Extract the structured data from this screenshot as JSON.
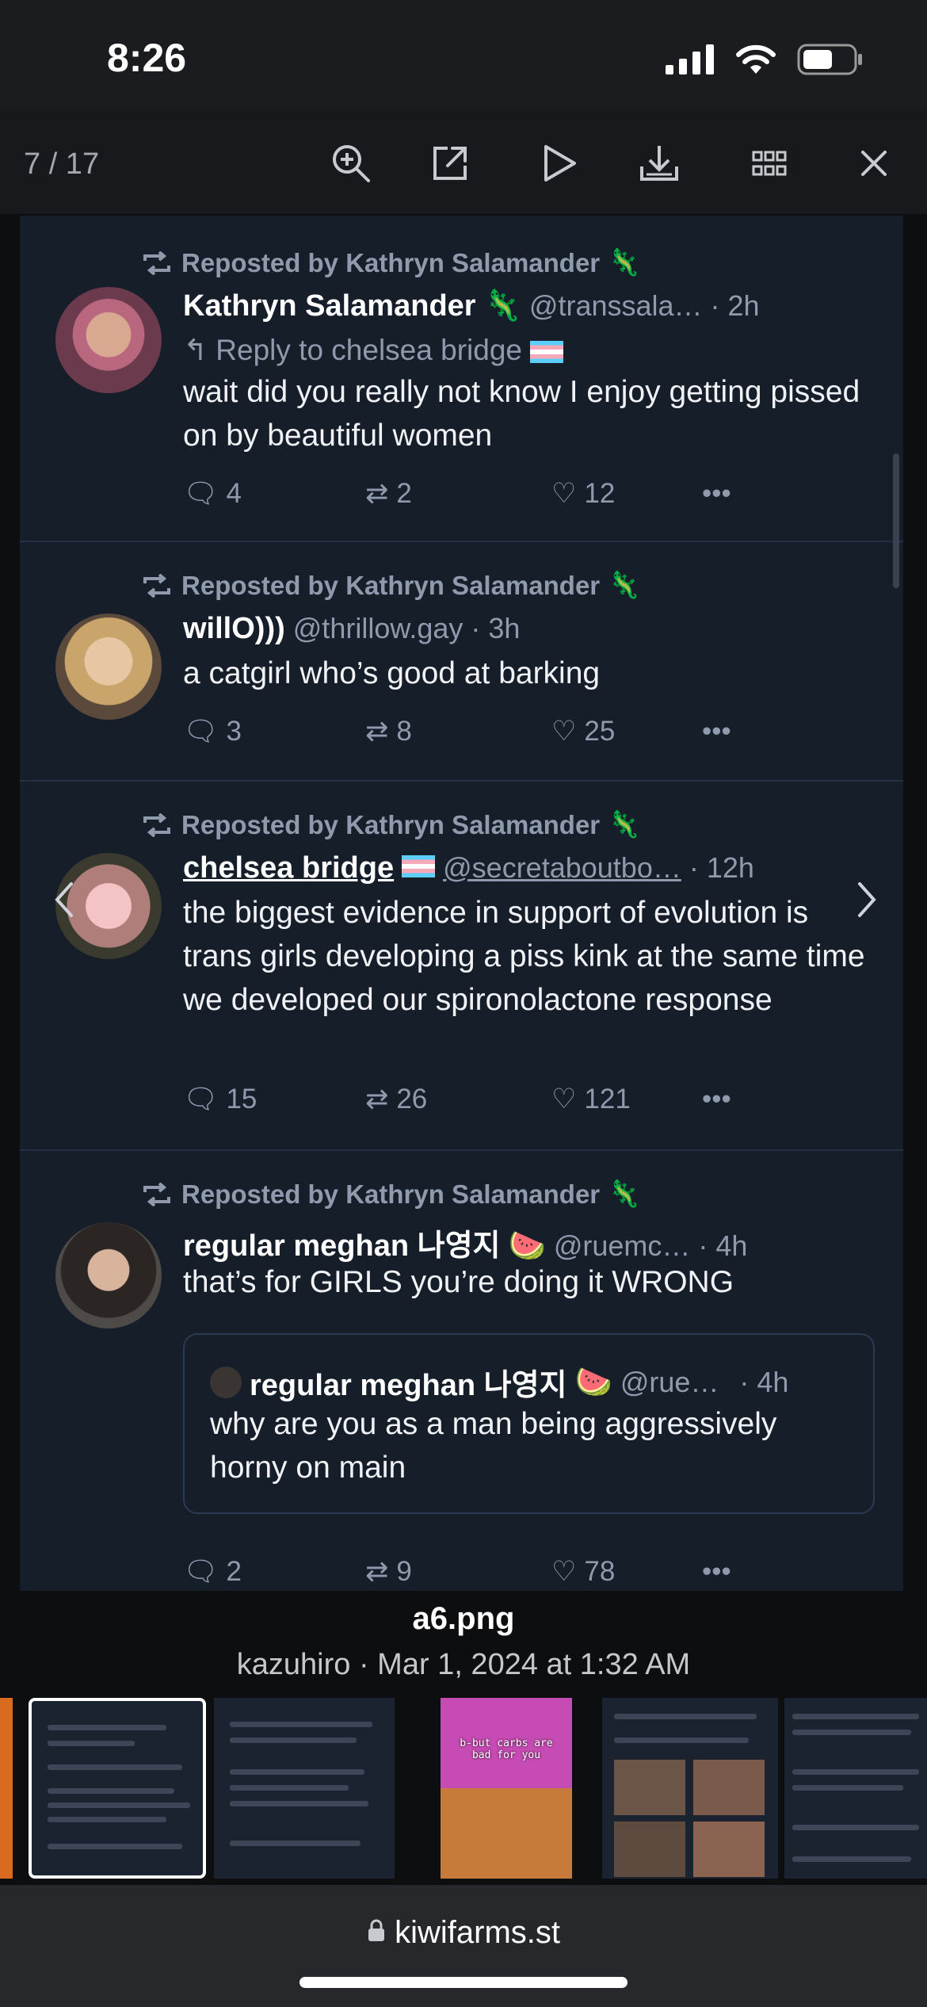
{
  "status_bar": {
    "time": "8:26"
  },
  "viewer": {
    "counter": "7 / 17",
    "icons": [
      "zoom-in-icon",
      "open-external-icon",
      "play-icon",
      "download-icon",
      "grid-icon",
      "close-icon"
    ]
  },
  "posts": [
    {
      "repost_label": "Reposted by Kathryn Salamander",
      "name": "Kathryn Salamander",
      "handle": "@transsala…",
      "time": "· 2h",
      "reply_to": "Reply to chelsea bridge",
      "text": "wait did you really not know I enjoy getting pissed on by beautiful women",
      "replies": "4",
      "reposts": "2",
      "likes": "12"
    },
    {
      "repost_label": "Reposted by Kathryn Salamander",
      "name": "willO)))",
      "handle": "@thrillow.gay",
      "time": "· 3h",
      "text": "a catgirl who’s good at barking",
      "replies": "3",
      "reposts": "8",
      "likes": "25"
    },
    {
      "repost_label": "Reposted by Kathryn Salamander",
      "name": "chelsea bridge",
      "handle": "@secretaboutbo…",
      "time": "· 12h",
      "text": "the biggest evidence in support of evolution is trans girls developing a piss kink at the same time we developed our spironolactone response",
      "replies": "15",
      "reposts": "26",
      "likes": "121"
    },
    {
      "repost_label": "Reposted by Kathryn Salamander",
      "name": "regular meghan 나영지",
      "handle": "@ruemc…",
      "time": "· 4h",
      "text": "that’s for GIRLS you’re doing it WRONG",
      "quote": {
        "name": "regular meghan 나영지",
        "handle": "@rue…",
        "time": "· 4h",
        "text": "why are you as a man being aggressively horny on main"
      },
      "replies": "2",
      "reposts": "9",
      "likes": "78"
    }
  ],
  "caption": {
    "filename": "a6.png",
    "meta": "kazuhiro · Mar 1, 2024 at 1:32 AM"
  },
  "thumbnail_caption_text": "b-but carbs are bad for you",
  "browser": {
    "url": "kiwifarms.st"
  },
  "colors": {
    "post_bg": "#161e2a",
    "muted": "#8f9bad",
    "divider": "#243044"
  }
}
